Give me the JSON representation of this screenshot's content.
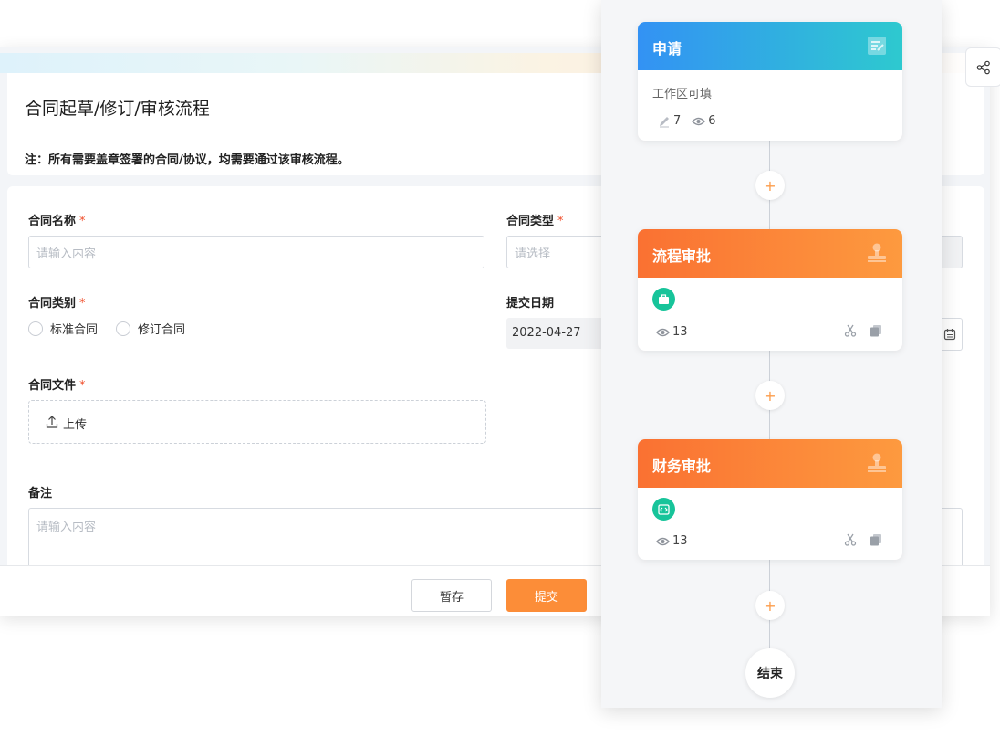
{
  "form": {
    "title": "合同起草/修订/审核流程",
    "note": "注：所有需要盖章签署的合同/协议，均需要通过该审核流程。",
    "fields": {
      "contract_name": {
        "label": "合同名称",
        "required": "*",
        "placeholder": "请输入内容"
      },
      "contract_type": {
        "label": "合同类型",
        "required": "*",
        "placeholder": "请选择"
      },
      "contract_category": {
        "label": "合同类别",
        "required": "*",
        "options": [
          "标准合同",
          "修订合同"
        ]
      },
      "submit_date": {
        "label": "提交日期",
        "value": "2022-04-27"
      },
      "contract_file": {
        "label": "合同文件",
        "required": "*",
        "upload_label": "上传"
      },
      "remark": {
        "label": "备注",
        "placeholder": "请输入内容"
      }
    },
    "footer": {
      "save_label": "暂存",
      "submit_label": "提交"
    }
  },
  "flow": {
    "add_symbol": "+",
    "nodes": [
      {
        "title": "申请",
        "subtitle": "工作区可填",
        "edit_count": "7",
        "view_count": "6",
        "header_color": "#3392f4",
        "icon": "form-icon"
      },
      {
        "title": "流程审批",
        "view_count": "13",
        "header_color": "#fa7132",
        "icon": "stamp-icon",
        "badge_icon": "briefcase-icon"
      },
      {
        "title": "财务审批",
        "view_count": "13",
        "header_color": "#fa7132",
        "icon": "stamp-icon",
        "badge_icon": "code-icon"
      }
    ],
    "end_label": "结束"
  },
  "colors": {
    "accent": "#fc8d38",
    "required": "#f0502d",
    "badge": "#17c49a"
  }
}
